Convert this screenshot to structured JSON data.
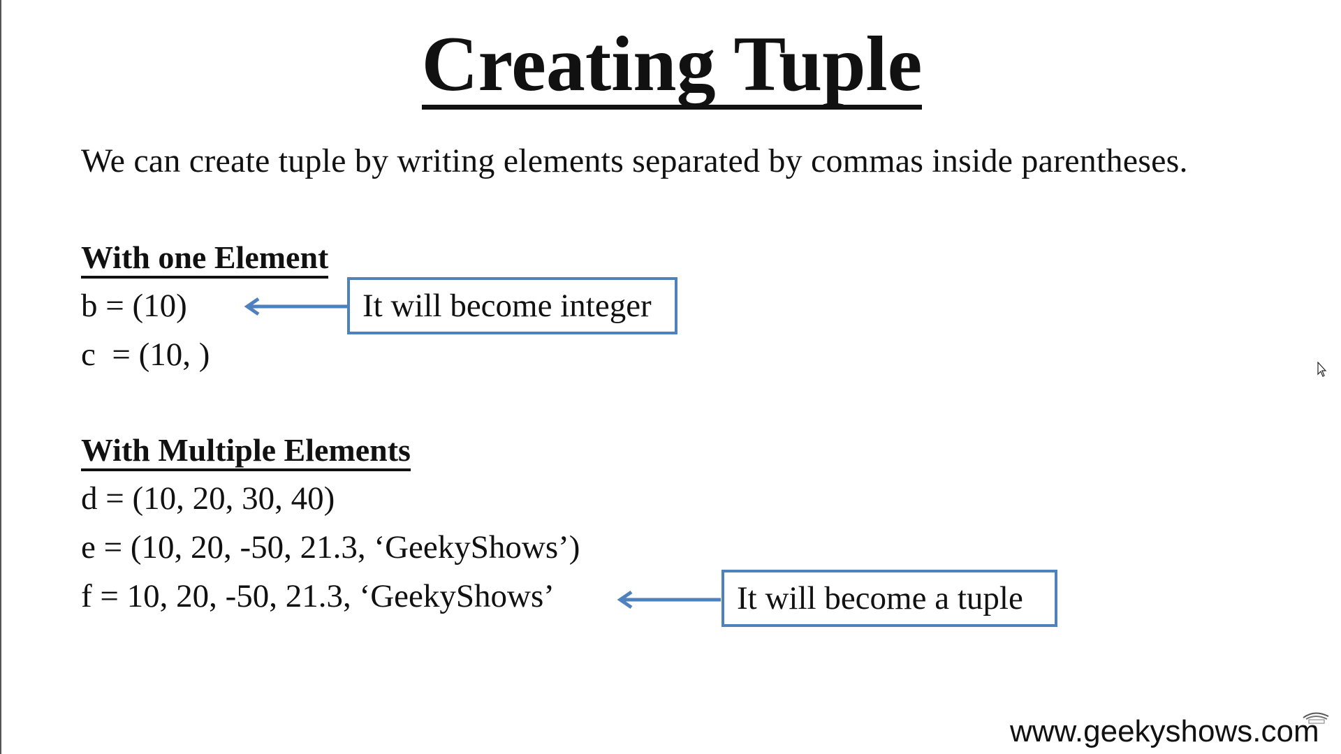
{
  "slide": {
    "title": "Creating Tuple",
    "intro": "We can create tuple by writing elements separated by commas inside parentheses."
  },
  "single_element": {
    "heading": "With one Element",
    "lines": [
      "b = (10)",
      "c  = (10, )"
    ],
    "callout": "It will become integer"
  },
  "multiple_elements": {
    "heading": "With Multiple Elements",
    "lines": [
      "d = (10, 20, 30, 40)",
      "e = (10, 20, -50, 21.3, ‘GeekyShows’)",
      "f = 10, 20, -50, 21.3, ‘GeekyShows’"
    ],
    "callout": "It will become a tuple"
  },
  "footer": {
    "url": "www.geekyshows.com"
  },
  "colors": {
    "callout_border": "#4f81bd",
    "arrow": "#4f81bd",
    "text": "#111111"
  },
  "icons": [
    "mouse-cursor-icon",
    "geekyshows-logo-icon"
  ]
}
